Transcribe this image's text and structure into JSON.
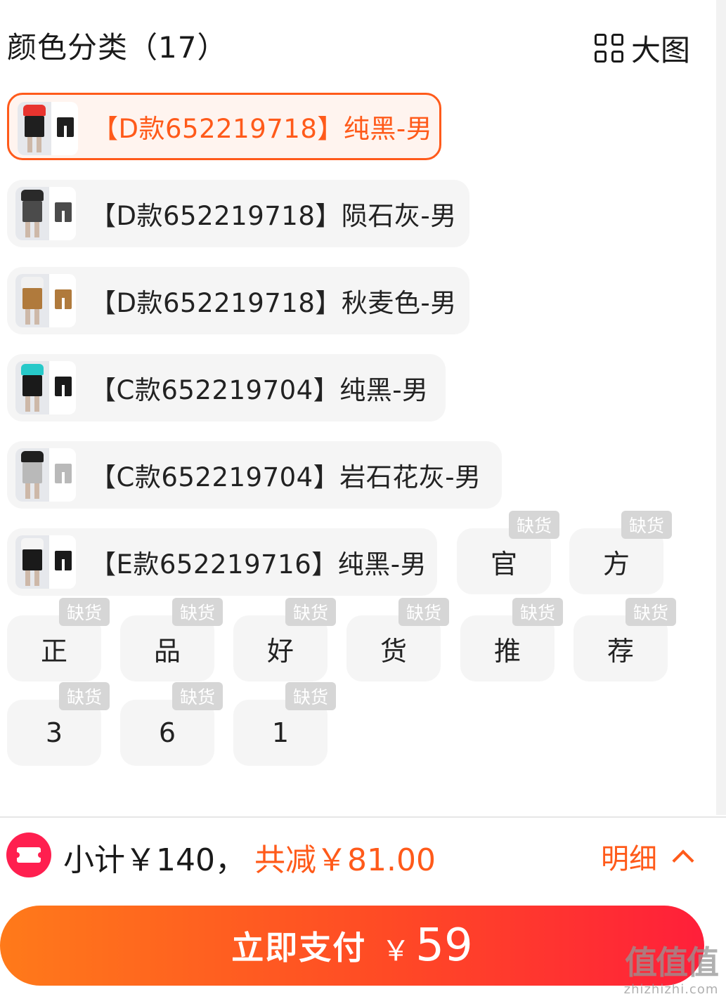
{
  "header": {
    "title": "颜色分类（17）",
    "big_view_label": "大图"
  },
  "color_options": [
    {
      "label": "【D款652219718】纯黑-男",
      "selected": true,
      "shirt_color": "#e8342f",
      "pants_color": "#1f1f1f"
    },
    {
      "label": "【D款652219718】陨石灰-男",
      "selected": false,
      "shirt_color": "#2a2a2a",
      "pants_color": "#4b4b4b"
    },
    {
      "label": "【D款652219718】秋麦色-男",
      "selected": false,
      "shirt_color": "#f1f1f1",
      "pants_color": "#b07a3c"
    },
    {
      "label": "【C款652219704】纯黑-男",
      "selected": false,
      "shirt_color": "#27c9c9",
      "pants_color": "#1a1a1a"
    },
    {
      "label": "【C款652219704】岩石花灰-男",
      "selected": false,
      "shirt_color": "#1f1f1f",
      "pants_color": "#b9b9b9"
    },
    {
      "label": "【E款652219716】纯黑-男",
      "selected": false,
      "shirt_color": "#f5f5f5",
      "pants_color": "#1a1a1a"
    }
  ],
  "char_options": [
    {
      "label": "官",
      "badge": "缺货"
    },
    {
      "label": "方",
      "badge": "缺货"
    },
    {
      "label": "正",
      "badge": "缺货"
    },
    {
      "label": "品",
      "badge": "缺货"
    },
    {
      "label": "好",
      "badge": "缺货"
    },
    {
      "label": "货",
      "badge": "缺货"
    },
    {
      "label": "推",
      "badge": "缺货"
    },
    {
      "label": "荐",
      "badge": "缺货"
    },
    {
      "label": "3",
      "badge": "缺货"
    },
    {
      "label": "6",
      "badge": "缺货"
    },
    {
      "label": "1",
      "badge": "缺货"
    }
  ],
  "footer": {
    "subtotal": "小计￥140，",
    "discount": "共减￥81.00",
    "detail_label": "明细",
    "pay_label": "立即支付",
    "pay_currency": "￥",
    "pay_amount": "59"
  },
  "watermark": {
    "main": "值值值",
    "sub": "zhizhizhi.com"
  },
  "colors": {
    "accent": "#ff5a1a",
    "selected_bg": "#fff4ef",
    "option_bg": "#f5f5f5",
    "badge_bg": "#d6d6d6",
    "coupon_red": "#ff1f4f"
  }
}
